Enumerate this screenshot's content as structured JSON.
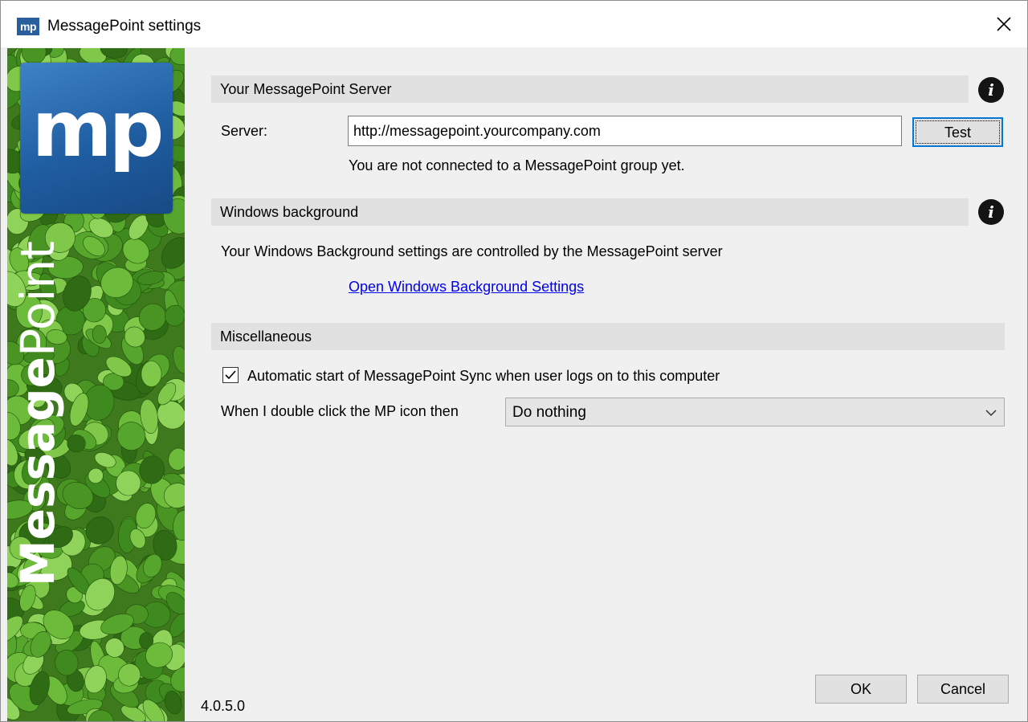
{
  "window": {
    "title": "MessagePoint settings",
    "app_icon_text": "mp",
    "close_icon": "close-icon"
  },
  "sidebar": {
    "logo_text": "mp",
    "brand_bold": "Message",
    "brand_light": "Point",
    "colors": {
      "logo_blue": "#2a5f9e",
      "leaf_green": "#4f9a2a"
    }
  },
  "server_section": {
    "header": "Your MessagePoint Server",
    "server_label": "Server:",
    "server_value": "http://messagepoint.yourcompany.com",
    "test_button": "Test",
    "status_text": "You are not connected to a MessagePoint group yet."
  },
  "background_section": {
    "header": "Windows background",
    "info_text": "Your Windows Background settings are controlled by the MessagePoint server",
    "link_text": "Open Windows Background Settings"
  },
  "misc_section": {
    "header": "Miscellaneous",
    "autostart_label": "Automatic start of MessagePoint Sync when user logs on to this computer",
    "autostart_checked": true,
    "double_click_label": "When I double click the MP icon then",
    "double_click_value": "Do nothing"
  },
  "footer": {
    "version": "4.0.5.0",
    "ok_button": "OK",
    "cancel_button": "Cancel"
  },
  "accent_color": "#0078d7"
}
